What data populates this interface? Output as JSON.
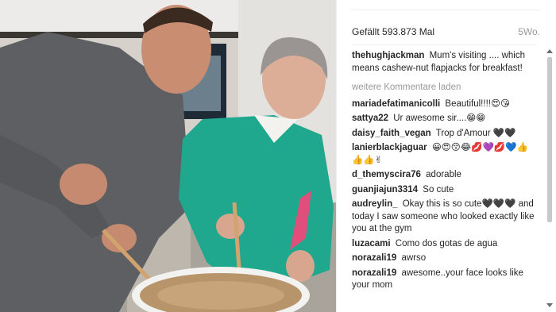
{
  "post": {
    "likes": "Gefällt 593.873 Mal",
    "age": "5Wo.",
    "caption": {
      "user": "thehughjackman",
      "text": "Mum's visiting .... which means cashew-nut flapjacks for breakfast!"
    },
    "load_more": "weitere Kommentare laden",
    "comments": [
      {
        "user": "mariadefatimanicolli",
        "text": "Beautiful!!!!😍😘"
      },
      {
        "user": "sattya22",
        "text": "Ur awesome sir....😁😁"
      },
      {
        "user": "daisy_faith_vegan",
        "text": "Trop d'Amour 🖤🖤"
      },
      {
        "user": "lanierblackjaguar",
        "text": "😀😍😚😂💋💜💋💙👍👍👍✌"
      },
      {
        "user": "d_themyscira76",
        "text": "adorable"
      },
      {
        "user": "guanjiajun3314",
        "text": "So cute"
      },
      {
        "user": "audreylin_",
        "text": "Okay this is so cute🖤🖤🖤 and today I saw someone who looked exactly like you at the gym"
      },
      {
        "user": "luzacami",
        "text": "Como dos gotas de agua"
      },
      {
        "user": "norazali19",
        "text": "awrso"
      },
      {
        "user": "norazali19",
        "text": "awesome..your face looks like your mom"
      }
    ]
  },
  "photo": {
    "description_icon": "photo-image",
    "colors": {
      "gray_shirt": "#5d5f62",
      "green_sweater": "#1fa88e",
      "kitchen_bg": "#d3cec6"
    }
  }
}
